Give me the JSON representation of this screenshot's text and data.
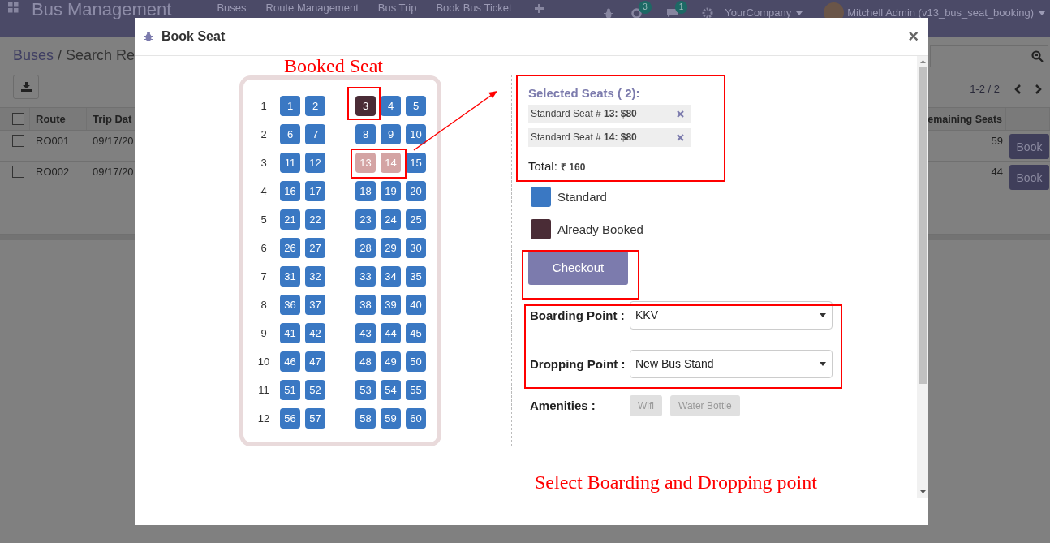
{
  "app": {
    "title": "Bus Management",
    "menu": [
      "Buses",
      "Route Management",
      "Bus Trip",
      "Book Bus Ticket"
    ],
    "activity_count": "3",
    "message_count": "1",
    "company": "YourCompany",
    "user": "Mitchell Admin (v13_bus_seat_booking)"
  },
  "breadcrumb": [
    "Buses",
    "/ Search Re"
  ],
  "pager": "1-2 / 2",
  "table": {
    "select_all_checked": false,
    "columns": [
      "Route",
      "Trip Dat",
      "emaining Seats"
    ],
    "rows": [
      {
        "checked": false,
        "route": "RO001",
        "trip_date": "09/17/20",
        "remaining_seats": "59",
        "action": "Book"
      },
      {
        "checked": false,
        "route": "RO002",
        "trip_date": "09/17/20",
        "remaining_seats": "44",
        "action": "Book"
      }
    ]
  },
  "dialog": {
    "title": "Book Seat",
    "close": "×",
    "seat_rows": [
      {
        "label": "1",
        "seats": [
          {
            "number": "1",
            "booked": false,
            "selected": false
          },
          {
            "number": "2",
            "booked": false,
            "selected": false
          },
          {
            "number": "3",
            "booked": true,
            "selected": false
          },
          {
            "number": "4",
            "booked": false,
            "selected": false
          },
          {
            "number": "5",
            "booked": false,
            "selected": false
          }
        ]
      },
      {
        "label": "2",
        "seats": [
          {
            "number": "6",
            "booked": false,
            "selected": false
          },
          {
            "number": "7",
            "booked": false,
            "selected": false
          },
          {
            "number": "8",
            "booked": false,
            "selected": false
          },
          {
            "number": "9",
            "booked": false,
            "selected": false
          },
          {
            "number": "10",
            "booked": false,
            "selected": false
          }
        ]
      },
      {
        "label": "3",
        "seats": [
          {
            "number": "11",
            "booked": false,
            "selected": false
          },
          {
            "number": "12",
            "booked": false,
            "selected": false
          },
          {
            "number": "13",
            "booked": false,
            "selected": true
          },
          {
            "number": "14",
            "booked": false,
            "selected": true
          },
          {
            "number": "15",
            "booked": false,
            "selected": false
          }
        ]
      },
      {
        "label": "4",
        "seats": [
          {
            "number": "16",
            "booked": false,
            "selected": false
          },
          {
            "number": "17",
            "booked": false,
            "selected": false
          },
          {
            "number": "18",
            "booked": false,
            "selected": false
          },
          {
            "number": "19",
            "booked": false,
            "selected": false
          },
          {
            "number": "20",
            "booked": false,
            "selected": false
          }
        ]
      },
      {
        "label": "5",
        "seats": [
          {
            "number": "21",
            "booked": false,
            "selected": false
          },
          {
            "number": "22",
            "booked": false,
            "selected": false
          },
          {
            "number": "23",
            "booked": false,
            "selected": false
          },
          {
            "number": "24",
            "booked": false,
            "selected": false
          },
          {
            "number": "25",
            "booked": false,
            "selected": false
          }
        ]
      },
      {
        "label": "6",
        "seats": [
          {
            "number": "26",
            "booked": false,
            "selected": false
          },
          {
            "number": "27",
            "booked": false,
            "selected": false
          },
          {
            "number": "28",
            "booked": false,
            "selected": false
          },
          {
            "number": "29",
            "booked": false,
            "selected": false
          },
          {
            "number": "30",
            "booked": false,
            "selected": false
          }
        ]
      },
      {
        "label": "7",
        "seats": [
          {
            "number": "31",
            "booked": false,
            "selected": false
          },
          {
            "number": "32",
            "booked": false,
            "selected": false
          },
          {
            "number": "33",
            "booked": false,
            "selected": false
          },
          {
            "number": "34",
            "booked": false,
            "selected": false
          },
          {
            "number": "35",
            "booked": false,
            "selected": false
          }
        ]
      },
      {
        "label": "8",
        "seats": [
          {
            "number": "36",
            "booked": false,
            "selected": false
          },
          {
            "number": "37",
            "booked": false,
            "selected": false
          },
          {
            "number": "38",
            "booked": false,
            "selected": false
          },
          {
            "number": "39",
            "booked": false,
            "selected": false
          },
          {
            "number": "40",
            "booked": false,
            "selected": false
          }
        ]
      },
      {
        "label": "9",
        "seats": [
          {
            "number": "41",
            "booked": false,
            "selected": false
          },
          {
            "number": "42",
            "booked": false,
            "selected": false
          },
          {
            "number": "43",
            "booked": false,
            "selected": false
          },
          {
            "number": "44",
            "booked": false,
            "selected": false
          },
          {
            "number": "45",
            "booked": false,
            "selected": false
          }
        ]
      },
      {
        "label": "10",
        "seats": [
          {
            "number": "46",
            "booked": false,
            "selected": false
          },
          {
            "number": "47",
            "booked": false,
            "selected": false
          },
          {
            "number": "48",
            "booked": false,
            "selected": false
          },
          {
            "number": "49",
            "booked": false,
            "selected": false
          },
          {
            "number": "50",
            "booked": false,
            "selected": false
          }
        ]
      },
      {
        "label": "11",
        "seats": [
          {
            "number": "51",
            "booked": false,
            "selected": false
          },
          {
            "number": "52",
            "booked": false,
            "selected": false
          },
          {
            "number": "53",
            "booked": false,
            "selected": false
          },
          {
            "number": "54",
            "booked": false,
            "selected": false
          },
          {
            "number": "55",
            "booked": false,
            "selected": false
          }
        ]
      },
      {
        "label": "12",
        "seats": [
          {
            "number": "56",
            "booked": false,
            "selected": false
          },
          {
            "number": "57",
            "booked": false,
            "selected": false
          },
          {
            "number": "58",
            "booked": false,
            "selected": false
          },
          {
            "number": "59",
            "booked": false,
            "selected": false
          },
          {
            "number": "60",
            "booked": false,
            "selected": false
          }
        ]
      }
    ],
    "selected_heading": "Selected Seats ( 2):",
    "selected_seats": [
      "Standard Seat # **13: $80**",
      "Standard Seat # **14: $80**"
    ],
    "total": "Total: **₹ 160**",
    "legend": [
      {
        "label": "Standard",
        "color": "#3a78c3"
      },
      {
        "label": "Already Booked",
        "color": "#4a2c36"
      }
    ],
    "checkout": "Checkout",
    "boarding": {
      "label": "Boarding Point :",
      "value": "KKV"
    },
    "dropping": {
      "label": "Dropping Point :",
      "value": "New Bus Stand"
    },
    "amenities": {
      "label": "Amenities :",
      "items": [
        "Wifi",
        "Water Bottle"
      ]
    }
  },
  "annotations": {
    "booked_seat": "Booked Seat",
    "boarding_note": "Select Boarding and Dropping point"
  }
}
